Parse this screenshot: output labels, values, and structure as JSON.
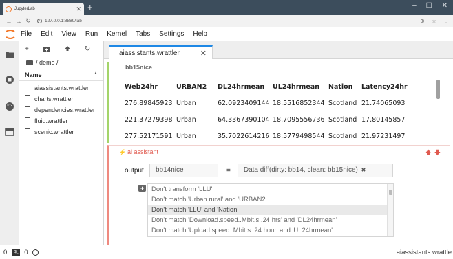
{
  "browser": {
    "tab_title": "JupyterLab",
    "url": "127.0.0.1:8889/lab"
  },
  "menu": [
    "File",
    "Edit",
    "View",
    "Run",
    "Kernel",
    "Tabs",
    "Settings",
    "Help"
  ],
  "file_browser": {
    "breadcrumb": "/ demo /",
    "column_header": "Name",
    "files": [
      "aiassistants.wrattler",
      "charts.wrattler",
      "dependencies.wrattler",
      "fluid.wrattler",
      "scenic.wrattler"
    ]
  },
  "document_tab": {
    "label": "aiassistants.wrattler"
  },
  "cell1": {
    "title": "bb15nice",
    "columns": [
      "Web24hr",
      "URBAN2",
      "DL24hrmean",
      "UL24hrmean",
      "Nation",
      "Latency24hr"
    ],
    "rows": [
      [
        "276.89845923",
        "Urban",
        "62.0923409144",
        "18.5516852344",
        "Scotland",
        "21.74065093"
      ],
      [
        "221.37279398",
        "Urban",
        "64.3367390104",
        "18.7095556736",
        "Scotland",
        "17.80145857"
      ],
      [
        "277.52171591",
        "Urban",
        "35.7022614216",
        "18.5779498544",
        "Scotland",
        "21.97231497"
      ]
    ]
  },
  "cell2": {
    "header": "ai assistant",
    "output_label": "output",
    "output_value": "bb14nice",
    "equals": "=",
    "expression": "Data diff(dirty: bb14, clean: bb15nice)",
    "suggestions": [
      "Don't transform 'LLU'",
      "Don't match 'Urban.rural' and 'URBAN2'",
      "Don't match 'LLU' and 'Nation'",
      "Don't match 'Download.speed..Mbit.s..24.hrs' and 'DL24hrmean'",
      "Don't match 'Upload.speed..Mbit.s..24.hour' and 'UL24hrmean'"
    ],
    "selected_index": 2
  },
  "status": {
    "left_count1": "0",
    "left_count2": "0",
    "right_text": "aiassistants.wrattle"
  }
}
